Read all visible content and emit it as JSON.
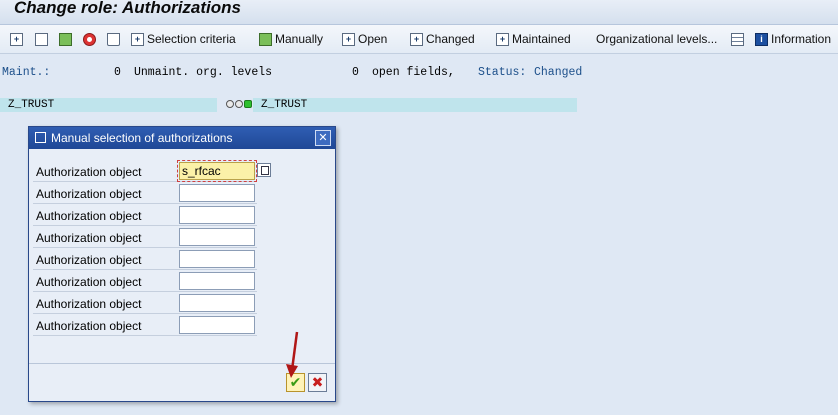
{
  "window": {
    "title": "Change role: Authorizations"
  },
  "toolbar": {
    "items": [
      {
        "label": "Selection criteria"
      },
      {
        "label": "Manually"
      },
      {
        "label": "Open"
      },
      {
        "label": "Changed"
      },
      {
        "label": "Maintained"
      },
      {
        "label": "Organizational levels..."
      },
      {
        "label": "Information"
      }
    ]
  },
  "status": {
    "maint_label": "Maint.:",
    "maint_value": "0",
    "unmaint_label": "Unmaint. org. levels",
    "unmaint_value": "0",
    "open_fields": "open fields,",
    "status_label": "Status:",
    "status_value": "Changed"
  },
  "role": {
    "name_left": "Z_TRUST",
    "name_right": "Z_TRUST"
  },
  "dialog": {
    "title": "Manual selection of authorizations",
    "close": "✕",
    "rows": [
      {
        "label": "Authorization object",
        "value": "s_rfcac"
      },
      {
        "label": "Authorization object",
        "value": ""
      },
      {
        "label": "Authorization object",
        "value": ""
      },
      {
        "label": "Authorization object",
        "value": ""
      },
      {
        "label": "Authorization object",
        "value": ""
      },
      {
        "label": "Authorization object",
        "value": ""
      },
      {
        "label": "Authorization object",
        "value": ""
      },
      {
        "label": "Authorization object",
        "value": ""
      }
    ],
    "ok_glyph": "✔",
    "cancel_glyph": "✖"
  },
  "colors": {
    "accent": "#1f4896",
    "highlight": "#bfe4ec",
    "arrow": "#b01717"
  }
}
